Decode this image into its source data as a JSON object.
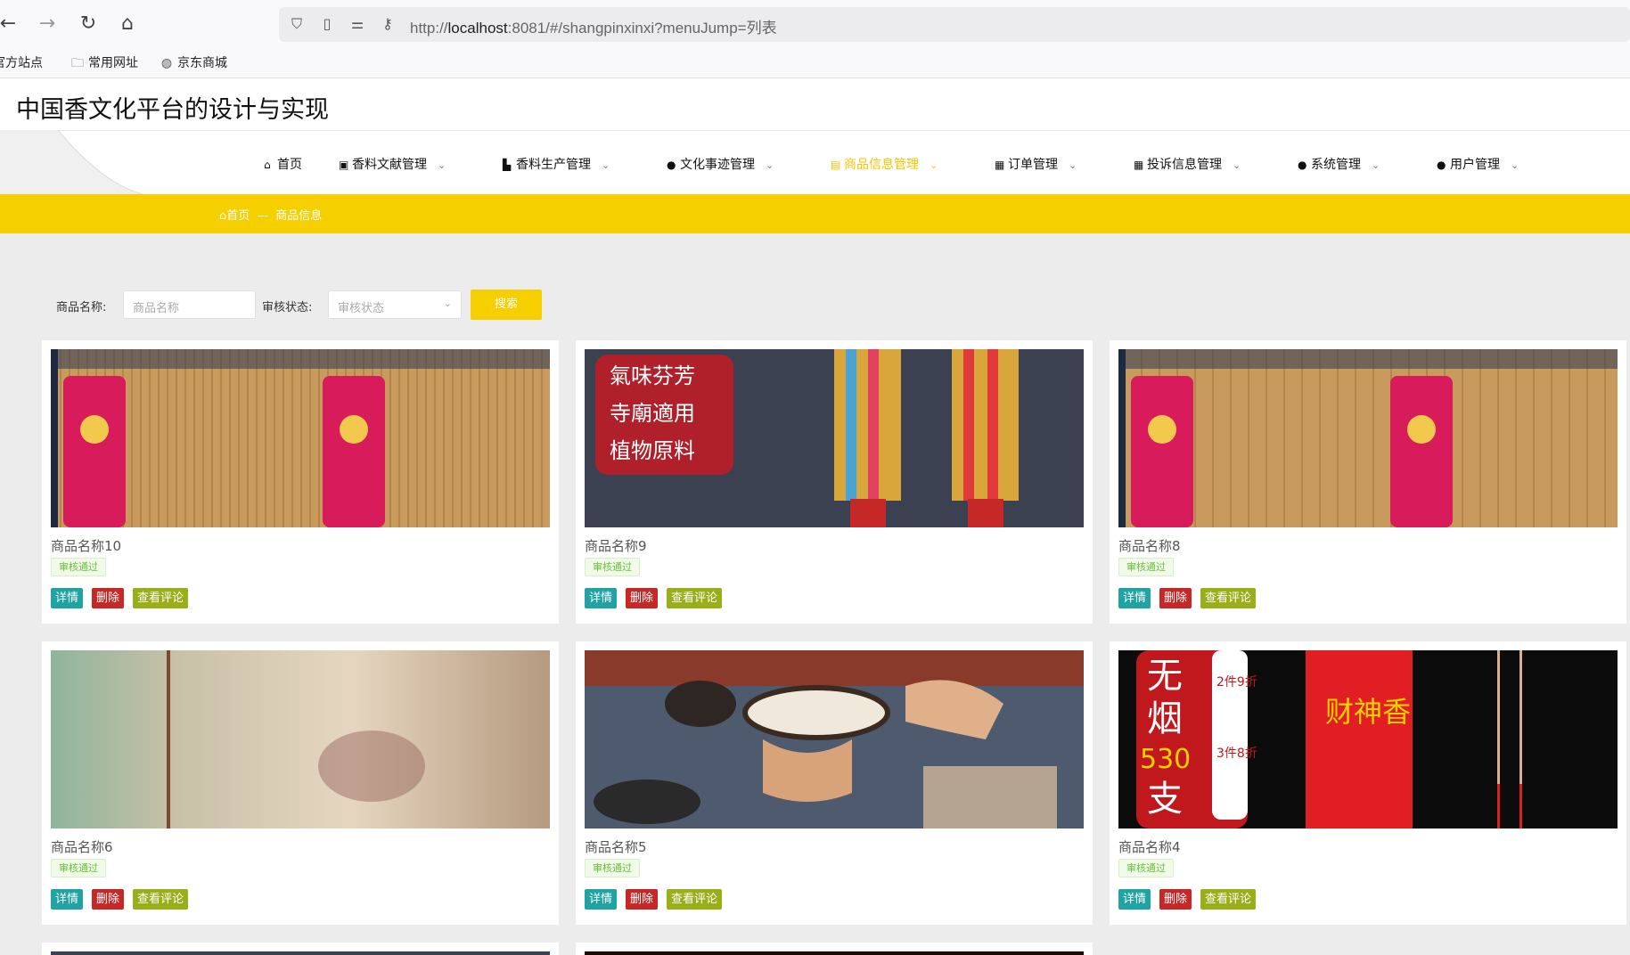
{
  "browser": {
    "url_scheme": "http://",
    "url_host": "localhost",
    "url_rest": ":8081/#/shangpinxinxi?menuJump=列表",
    "bookmarks": [
      "官方站点",
      "常用网址",
      "京东商城"
    ]
  },
  "site": {
    "title": "中国香文化平台的设计与实现"
  },
  "menu": [
    {
      "label": "首页",
      "icon": "home-icon",
      "has_dropdown": false,
      "active": false
    },
    {
      "label": "香料文献管理",
      "icon": "gift-icon",
      "has_dropdown": true,
      "active": false
    },
    {
      "label": "香料生产管理",
      "icon": "goods-icon",
      "has_dropdown": true,
      "active": false
    },
    {
      "label": "文化事迹管理",
      "icon": "more-icon",
      "has_dropdown": true,
      "active": false
    },
    {
      "label": "商品信息管理",
      "icon": "menu-icon",
      "has_dropdown": true,
      "active": true
    },
    {
      "label": "订单管理",
      "icon": "order-icon",
      "has_dropdown": true,
      "active": false
    },
    {
      "label": "投诉信息管理",
      "icon": "grid-icon",
      "has_dropdown": true,
      "active": false
    },
    {
      "label": "系统管理",
      "icon": "more-icon",
      "has_dropdown": true,
      "active": false
    },
    {
      "label": "用户管理",
      "icon": "user-icon",
      "has_dropdown": true,
      "active": false
    }
  ],
  "breadcrumb": {
    "home": "首页",
    "separator": "—",
    "current": "商品信息"
  },
  "search": {
    "name_label": "商品名称:",
    "name_placeholder": "商品名称",
    "status_label": "审核状态:",
    "status_placeholder": "审核状态",
    "button": "搜索"
  },
  "products": [
    {
      "name": "商品名称10",
      "status": "审核通过",
      "image": "incense-bundles"
    },
    {
      "name": "商品名称9",
      "status": "审核通过",
      "image": "temple-incense",
      "image_text": [
        "氣味芬芳",
        "寺廟適用",
        "植物原料"
      ]
    },
    {
      "name": "商品名称8",
      "status": "审核通过",
      "image": "incense-bundles"
    },
    {
      "name": "商品名称6",
      "status": "审核通过",
      "image": "blurred-incense-stick"
    },
    {
      "name": "商品名称5",
      "status": "审核通过",
      "image": "incense-burner-hands"
    },
    {
      "name": "商品名称4",
      "status": "审核通过",
      "image": "wealth-incense",
      "image_text": [
        "无",
        "烟",
        "530",
        "支",
        "2件9折",
        "3件8折",
        "财神香"
      ]
    }
  ],
  "card_buttons": {
    "detail": "详情",
    "delete": "删除",
    "comments": "查看评论"
  },
  "colors": {
    "accent": "#f5cf00",
    "detail_button": "#1fa3a3",
    "delete_button": "#c62828",
    "comment_button": "#9aae1a",
    "status_tag": "#67c23a"
  }
}
